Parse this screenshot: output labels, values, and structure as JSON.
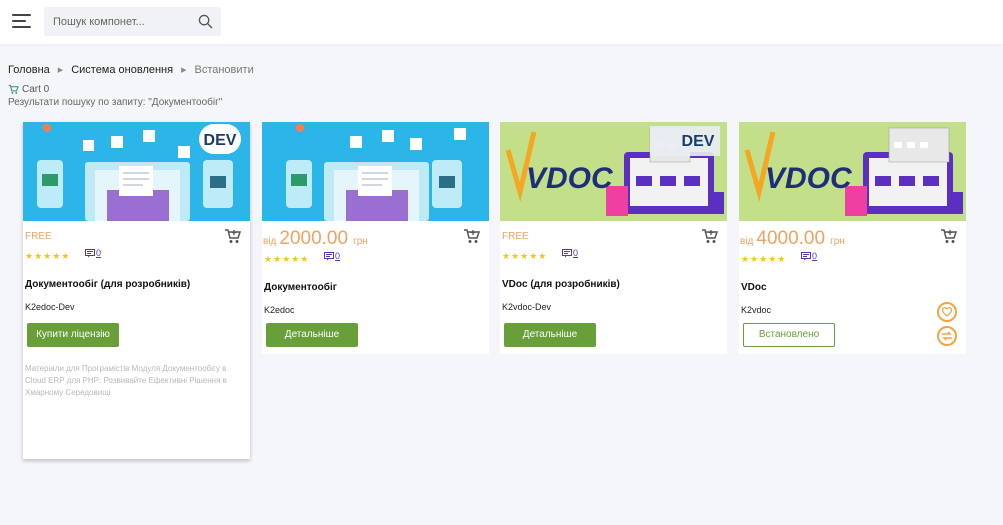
{
  "header": {
    "search_placeholder": "Пошук компонет..."
  },
  "breadcrumb": {
    "home": "Головна",
    "section": "Система оновлення",
    "current": "Встановити"
  },
  "cart": {
    "label": "Cart 0"
  },
  "results_text": "Результати пошуку по запиту: \"Документообіг\"",
  "colors": {
    "accent_green": "#689f38",
    "price_orange": "#f0a35f",
    "star_yellow": "#f5c518",
    "review_purple": "#5b33b3"
  },
  "cards": [
    {
      "badge": "DEV",
      "price_free": "FREE",
      "stars": "★★★★★",
      "reviews": "0",
      "title": "Документообіг (для розробників)",
      "code": "K2edoc-Dev",
      "button": "Купити ліцензію",
      "description": "Матеріали для Програмістів Модуля Документообігу в Cloud ERP для PHP: Розвивайте Ефективні Рішення в Хмарному Середовищі"
    },
    {
      "price_from": "від",
      "price": "2000.00",
      "currency": "грн",
      "stars": "★★★★★",
      "reviews": "0",
      "title": "Документообіг",
      "code": "K2edoc",
      "button": "Детальніше"
    },
    {
      "logo": "VDOC",
      "badge": "DEV",
      "price_free": "FREE",
      "stars": "★★★★★",
      "reviews": "0",
      "title": "VDoc (для розробників)",
      "code": "K2vdoc-Dev",
      "button": "Детальніше"
    },
    {
      "logo": "VDOC",
      "price_from": "від",
      "price": "4000.00",
      "currency": "грн",
      "stars": "★★★★★",
      "reviews": "0",
      "title": "VDoc",
      "code": "K2vdoc",
      "button": "Встановлено"
    }
  ]
}
